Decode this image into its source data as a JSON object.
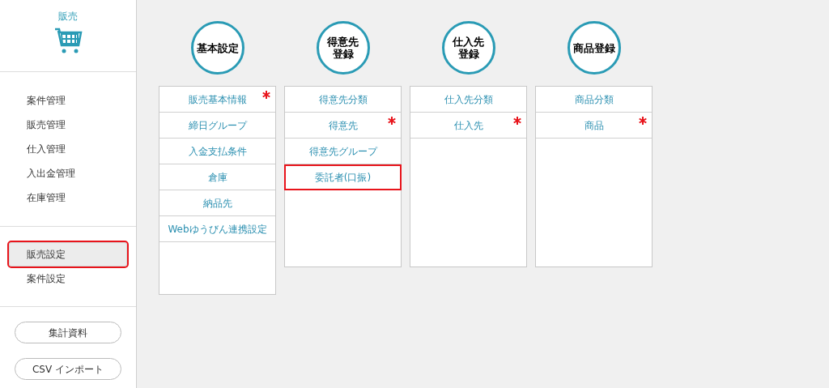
{
  "sidebar": {
    "title": "販売",
    "groups": [
      [
        {
          "label": "案件管理",
          "selected": false,
          "highlighted": false
        },
        {
          "label": "販売管理",
          "selected": false,
          "highlighted": false
        },
        {
          "label": "仕入管理",
          "selected": false,
          "highlighted": false
        },
        {
          "label": "入出金管理",
          "selected": false,
          "highlighted": false
        },
        {
          "label": "在庫管理",
          "selected": false,
          "highlighted": false
        }
      ],
      [
        {
          "label": "販売設定",
          "selected": true,
          "highlighted": true
        },
        {
          "label": "案件設定",
          "selected": false,
          "highlighted": false
        }
      ]
    ],
    "buttons": [
      "集計資料",
      "CSV インポート"
    ]
  },
  "columns": [
    {
      "title": [
        "基本設定"
      ],
      "items": [
        {
          "label": "販売基本情報",
          "required": true,
          "highlighted": false
        },
        {
          "label": "締日グループ",
          "required": false,
          "highlighted": false
        },
        {
          "label": "入金支払条件",
          "required": false,
          "highlighted": false
        },
        {
          "label": "倉庫",
          "required": false,
          "highlighted": false
        },
        {
          "label": "納品先",
          "required": false,
          "highlighted": false
        },
        {
          "label": "Webゆうびん連携設定",
          "required": false,
          "highlighted": false
        }
      ]
    },
    {
      "title": [
        "得意先",
        "登録"
      ],
      "items": [
        {
          "label": "得意先分類",
          "required": false,
          "highlighted": false
        },
        {
          "label": "得意先",
          "required": true,
          "highlighted": false
        },
        {
          "label": "得意先グループ",
          "required": false,
          "highlighted": false
        },
        {
          "label": "委託者(口振)",
          "required": false,
          "highlighted": true
        }
      ]
    },
    {
      "title": [
        "仕入先",
        "登録"
      ],
      "items": [
        {
          "label": "仕入先分類",
          "required": false,
          "highlighted": false
        },
        {
          "label": "仕入先",
          "required": true,
          "highlighted": false
        }
      ]
    },
    {
      "title": [
        "商品登録"
      ],
      "items": [
        {
          "label": "商品分類",
          "required": false,
          "highlighted": false
        },
        {
          "label": "商品",
          "required": true,
          "highlighted": false
        }
      ]
    }
  ]
}
